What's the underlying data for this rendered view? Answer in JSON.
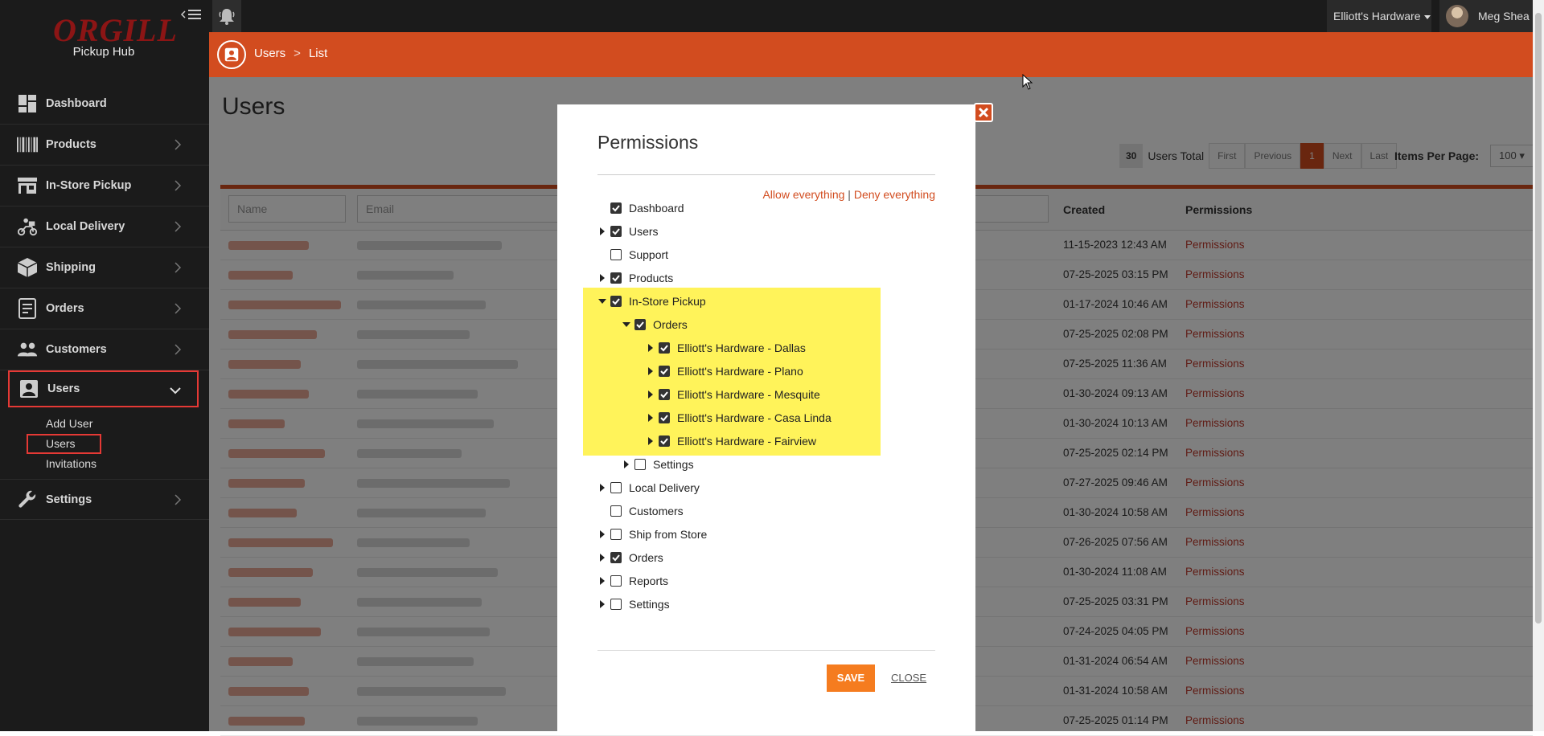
{
  "brand": {
    "logo": "ORGILL",
    "subtitle": "Pickup Hub"
  },
  "sidebar": {
    "items": [
      {
        "label": "Dashboard",
        "icon": "dashboard-icon"
      },
      {
        "label": "Products",
        "icon": "barcode-icon"
      },
      {
        "label": "In-Store Pickup",
        "icon": "store-icon"
      },
      {
        "label": "Local Delivery",
        "icon": "scooter-icon"
      },
      {
        "label": "Shipping",
        "icon": "box-icon"
      },
      {
        "label": "Orders",
        "icon": "orders-icon"
      },
      {
        "label": "Customers",
        "icon": "people-icon"
      },
      {
        "label": "Users",
        "icon": "user-card-icon"
      },
      {
        "label": "Settings",
        "icon": "wrench-icon"
      }
    ],
    "users_sub": [
      "Add User",
      "Users",
      "Invitations"
    ]
  },
  "topbar": {
    "store": "Elliott's Hardware",
    "user": "Meg Shea"
  },
  "breadcrumb": {
    "section": "Users",
    "page": "List"
  },
  "page": {
    "title": "Users"
  },
  "pager": {
    "count": "30",
    "total_label": "Users Total",
    "first": "First",
    "previous": "Previous",
    "current": "1",
    "next": "Next",
    "last": "Last",
    "items_per_page_label": "Items Per Page:",
    "items_per_page": "100"
  },
  "table": {
    "filters": {
      "name": "Name",
      "email": "Email"
    },
    "headers": {
      "created": "Created",
      "permissions": "Permissions"
    },
    "rows": [
      {
        "created": "11-15-2023 12:43 AM",
        "permissions": "Permissions"
      },
      {
        "created": "07-25-2025 03:15 PM",
        "permissions": "Permissions"
      },
      {
        "created": "01-17-2024 10:46 AM",
        "permissions": "Permissions"
      },
      {
        "created": "07-25-2025 02:08 PM",
        "permissions": "Permissions"
      },
      {
        "created": "07-25-2025 11:36 AM",
        "permissions": "Permissions"
      },
      {
        "created": "01-30-2024 09:13 AM",
        "permissions": "Permissions"
      },
      {
        "created": "01-30-2024 10:13 AM",
        "permissions": "Permissions"
      },
      {
        "created": "07-25-2025 02:14 PM",
        "permissions": "Permissions"
      },
      {
        "created": "07-27-2025 09:46 AM",
        "permissions": "Permissions"
      },
      {
        "created": "01-30-2024 10:58 AM",
        "permissions": "Permissions"
      },
      {
        "created": "07-26-2025 07:56 AM",
        "permissions": "Permissions"
      },
      {
        "created": "01-30-2024 11:08 AM",
        "permissions": "Permissions"
      },
      {
        "created": "07-25-2025 03:31 PM",
        "permissions": "Permissions"
      },
      {
        "created": "07-24-2025 04:05 PM",
        "permissions": "Permissions"
      },
      {
        "created": "01-31-2024 06:54 AM",
        "permissions": "Permissions"
      },
      {
        "created": "01-31-2024 10:58 AM",
        "permissions": "Permissions"
      },
      {
        "created": "07-25-2025 01:14 PM",
        "permissions": "Permissions"
      }
    ]
  },
  "modal": {
    "title": "Permissions",
    "allow_all": "Allow everything",
    "separator": "|",
    "deny_all": "Deny everything",
    "tree": [
      {
        "label": "Dashboard",
        "level": 0,
        "arrow": "none",
        "checked": true
      },
      {
        "label": "Users",
        "level": 0,
        "arrow": "right",
        "checked": true
      },
      {
        "label": "Support",
        "level": 0,
        "arrow": "none",
        "checked": false
      },
      {
        "label": "Products",
        "level": 0,
        "arrow": "right",
        "checked": true
      },
      {
        "label": "In-Store Pickup",
        "level": 0,
        "arrow": "down",
        "checked": true
      },
      {
        "label": "Orders",
        "level": 1,
        "arrow": "down",
        "checked": true
      },
      {
        "label": "Elliott's Hardware - Dallas",
        "level": 2,
        "arrow": "right",
        "checked": true
      },
      {
        "label": "Elliott's Hardware - Plano",
        "level": 2,
        "arrow": "right",
        "checked": true
      },
      {
        "label": "Elliott's Hardware - Mesquite",
        "level": 2,
        "arrow": "right",
        "checked": true
      },
      {
        "label": "Elliott's Hardware - Casa Linda",
        "level": 2,
        "arrow": "right",
        "checked": true
      },
      {
        "label": "Elliott's Hardware - Fairview",
        "level": 2,
        "arrow": "right",
        "checked": true
      },
      {
        "label": "Settings",
        "level": 1,
        "arrow": "right",
        "checked": false
      },
      {
        "label": "Local Delivery",
        "level": 0,
        "arrow": "right",
        "checked": false
      },
      {
        "label": "Customers",
        "level": 0,
        "arrow": "none",
        "checked": false
      },
      {
        "label": "Ship from Store",
        "level": 0,
        "arrow": "right",
        "checked": false
      },
      {
        "label": "Orders",
        "level": 0,
        "arrow": "right",
        "checked": true
      },
      {
        "label": "Reports",
        "level": 0,
        "arrow": "right",
        "checked": false
      },
      {
        "label": "Settings",
        "level": 0,
        "arrow": "right",
        "checked": false
      }
    ],
    "save": "SAVE",
    "close": "CLOSE"
  },
  "colors": {
    "accent": "#d24c1f",
    "highlight": "#fff35a",
    "save": "#f57c1f"
  }
}
